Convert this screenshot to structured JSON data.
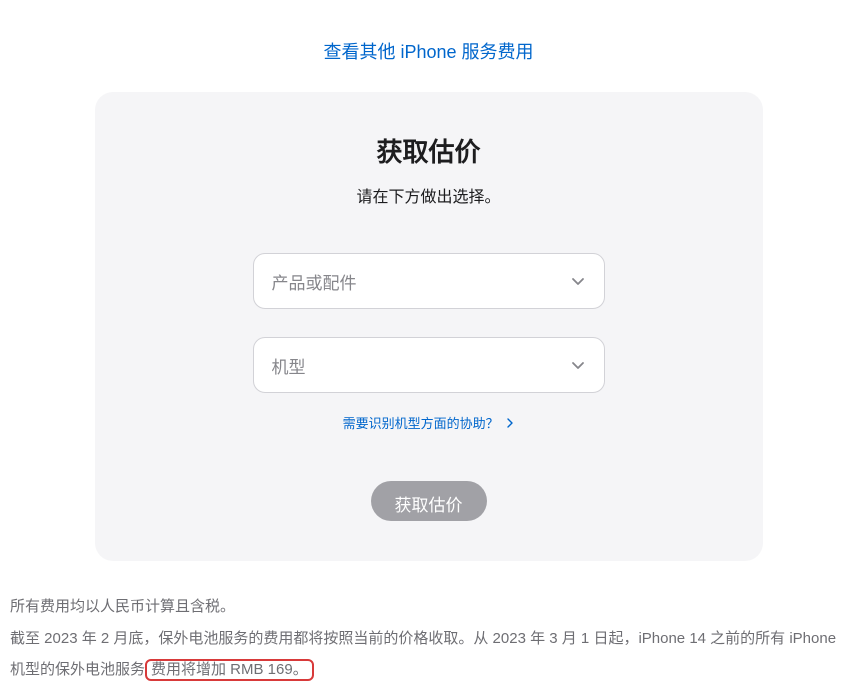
{
  "topLink": "查看其他 iPhone 服务费用",
  "card": {
    "title": "获取估价",
    "subtitle": "请在下方做出选择。",
    "select1Placeholder": "产品或配件",
    "select2Placeholder": "机型",
    "helpLink": "需要识别机型方面的协助？",
    "button": "获取估价"
  },
  "footer": {
    "line1": "所有费用均以人民币计算且含税。",
    "line2a": "截至 2023 年 2 月底，保外电池服务的费用都将按照当前的价格收取。从 2023 年 3 月 1 日起，iPhone 14 之前的所有 iPhone 机型的保外电池服务",
    "line2b": "费用将增加 RMB 169。"
  }
}
